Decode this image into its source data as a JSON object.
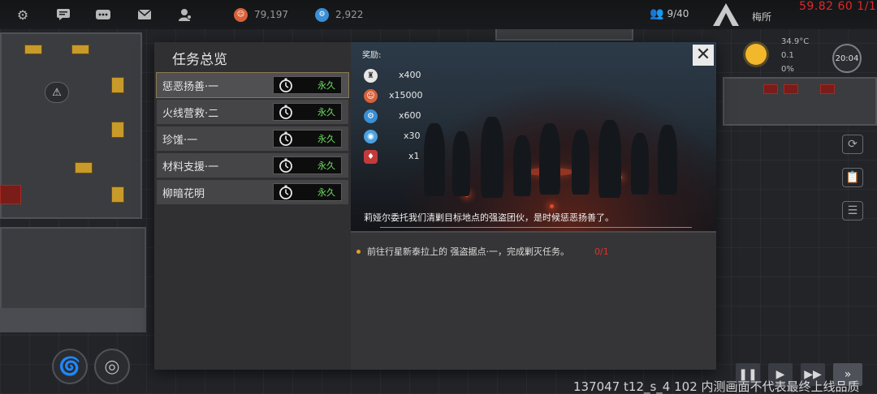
{
  "topbar": {
    "icons": [
      "gear-icon",
      "chat-bubble-icon",
      "chat-dots-icon",
      "mail-icon",
      "person-icon"
    ],
    "resource_1": {
      "icon": "orange-smiley-icon",
      "value": "79,197",
      "color": "#d8613a"
    },
    "resource_2": {
      "icon": "blue-gear-icon",
      "value": "2,922",
      "color": "#3a8fd6"
    },
    "population": "9/40",
    "player_name": "梅所",
    "fps_readout": "59.82 60 1/1"
  },
  "weather": {
    "temperature": "34.9°C",
    "wind": "0.1",
    "humidity": "0%",
    "time": "20:04"
  },
  "modal": {
    "title": "任务总览",
    "quests": [
      {
        "name": "惩恶扬善·一",
        "timer": "永久",
        "selected": true
      },
      {
        "name": "火线营救·二",
        "timer": "永久",
        "selected": false
      },
      {
        "name": "珍馐·一",
        "timer": "永久",
        "selected": false
      },
      {
        "name": "材料支援·一",
        "timer": "永久",
        "selected": false
      },
      {
        "name": "柳暗花明",
        "timer": "永久",
        "selected": false
      }
    ],
    "rewards_label": "奖励:",
    "rewards": [
      {
        "icon": "white-emblem-icon",
        "amount": "x400",
        "color": "#e6e6e6"
      },
      {
        "icon": "orange-smiley-icon",
        "amount": "x15000",
        "color": "#d8613a"
      },
      {
        "icon": "blue-gear-icon",
        "amount": "x600",
        "color": "#3a8fd6"
      },
      {
        "icon": "blue-tech-icon",
        "amount": "x30",
        "color": "#4aa2e0"
      },
      {
        "icon": "red-item-icon",
        "amount": "x1",
        "color": "#c43a3a"
      }
    ],
    "description": "莉娅尔委托我们清剿目标地点的强盗团伙，是时候惩恶扬善了。",
    "objective": "前往行星新泰拉上的 强盗据点·一，完成剿灭任务。",
    "objective_progress": "0/1",
    "close_label": "✕"
  },
  "bottom_right": {
    "build_info": "137047 t12_s_4 102  内测画面不代表最终上线品质"
  }
}
